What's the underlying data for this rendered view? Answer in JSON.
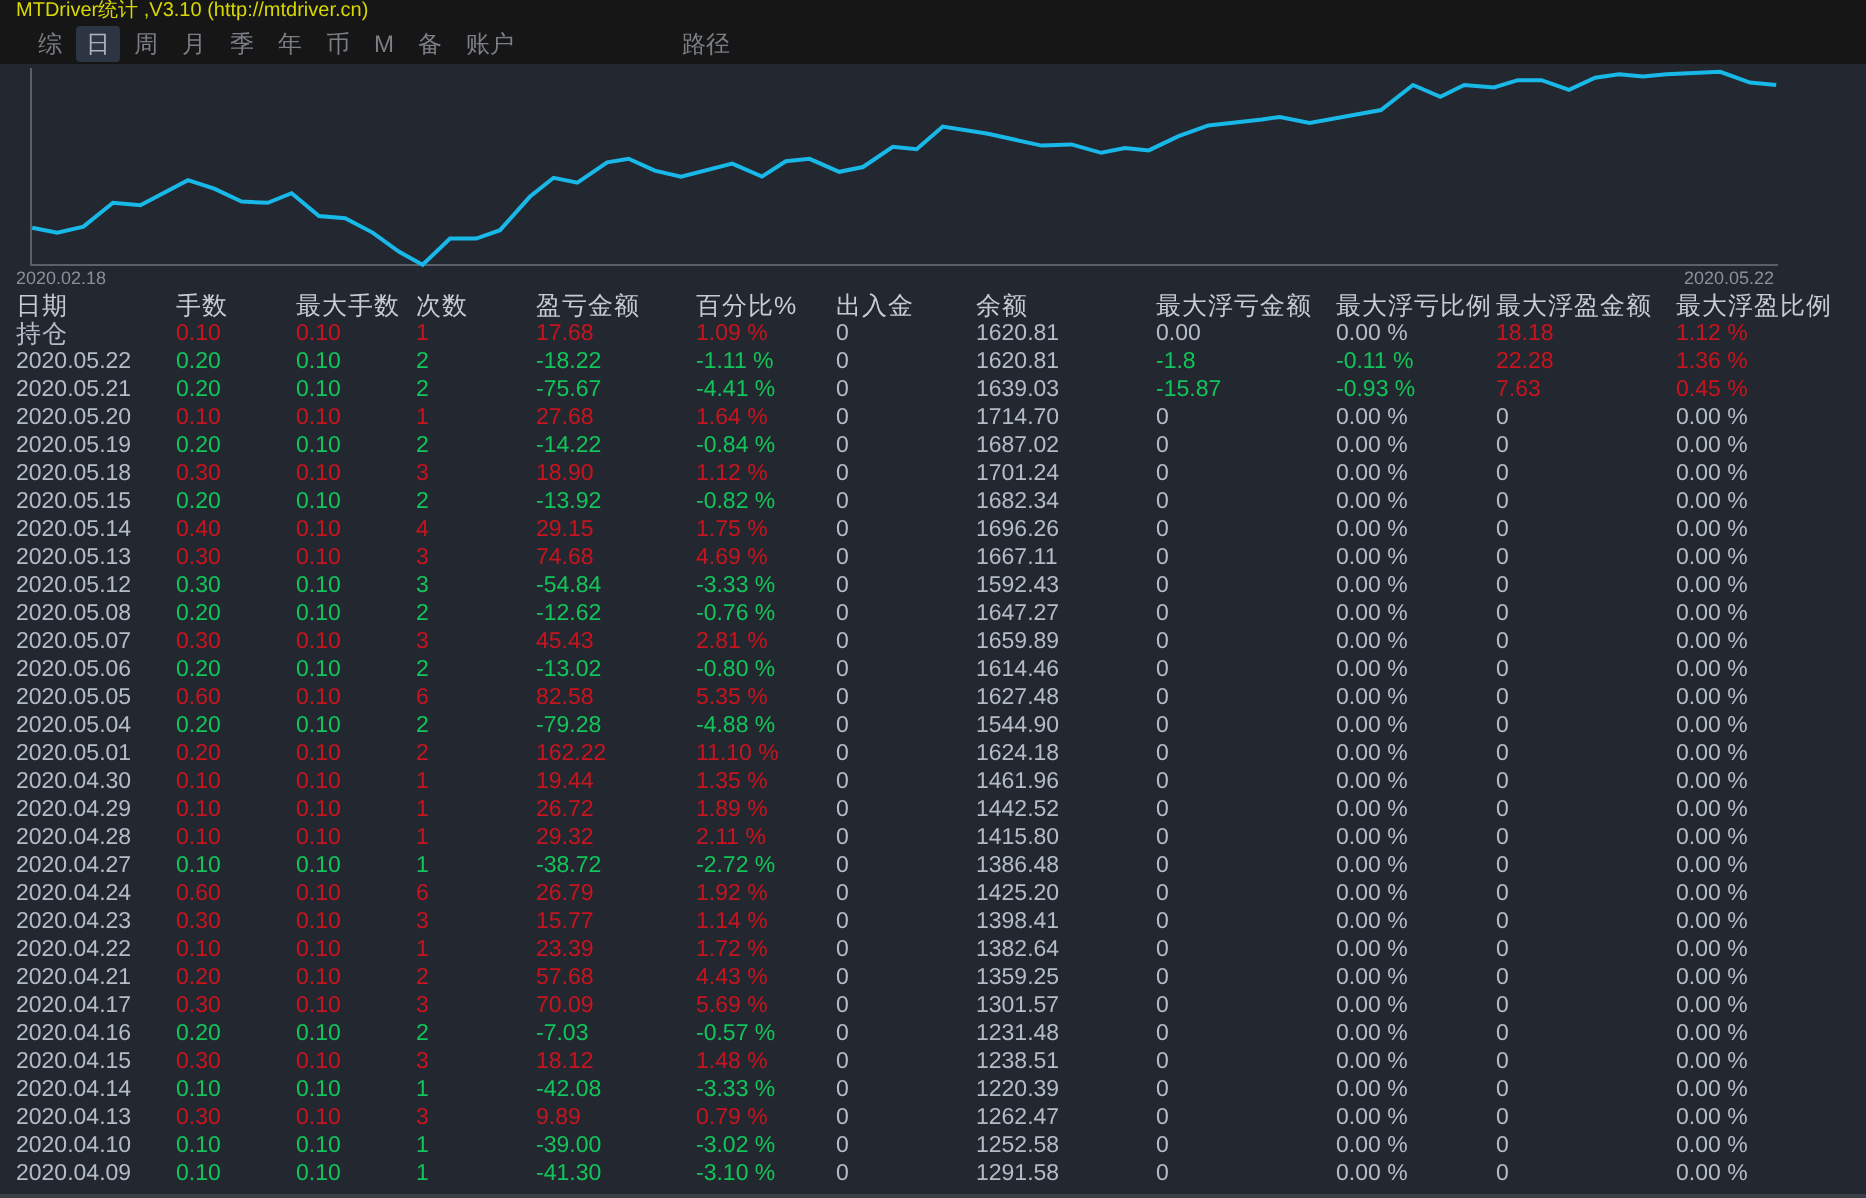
{
  "window": {
    "title": "MTDriver统计 ,V3.10 (http://mtdriver.cn)"
  },
  "tabs": [
    {
      "label": "综",
      "selected": false
    },
    {
      "label": "日",
      "selected": true
    },
    {
      "label": "周",
      "selected": false
    },
    {
      "label": "月",
      "selected": false
    },
    {
      "label": "季",
      "selected": false
    },
    {
      "label": "年",
      "selected": false
    },
    {
      "label": "币",
      "selected": false
    },
    {
      "label": "M",
      "selected": false
    },
    {
      "label": "备",
      "selected": false
    },
    {
      "label": "账户",
      "selected": false
    },
    {
      "label": "路径",
      "selected": false
    }
  ],
  "chart": {
    "start_label": "2020.02.18",
    "end_label": "2020.05.22"
  },
  "table": {
    "columns": [
      "日期",
      "手数",
      "最大手数",
      "次数",
      "盈亏金额",
      "百分比%",
      "出入金",
      "余额",
      "最大浮亏金额",
      "最大浮亏比例",
      "最大浮盈金额",
      "最大浮盈比例"
    ],
    "rows": [
      {
        "cells": [
          "持仓",
          "0.10",
          "0.10",
          "1",
          "17.68",
          "1.09 %",
          "0",
          "1620.81",
          "0.00",
          "0.00 %",
          "18.18",
          "1.12 %"
        ],
        "gain": true,
        "float_loss_marked": false,
        "float_profit_marked": true
      },
      {
        "cells": [
          "2020.05.22",
          "0.20",
          "0.10",
          "2",
          "-18.22",
          "-1.11 %",
          "0",
          "1620.81",
          "-1.8",
          "-0.11 %",
          "22.28",
          "1.36 %"
        ],
        "gain": false,
        "float_loss_marked": true,
        "float_profit_marked": true
      },
      {
        "cells": [
          "2020.05.21",
          "0.20",
          "0.10",
          "2",
          "-75.67",
          "-4.41 %",
          "0",
          "1639.03",
          "-15.87",
          "-0.93 %",
          "7.63",
          "0.45 %"
        ],
        "gain": false,
        "float_loss_marked": true,
        "float_profit_marked": true
      },
      {
        "cells": [
          "2020.05.20",
          "0.10",
          "0.10",
          "1",
          "27.68",
          "1.64 %",
          "0",
          "1714.70",
          "0",
          "0.00 %",
          "0",
          "0.00 %"
        ],
        "gain": true,
        "float_loss_marked": false,
        "float_profit_marked": false
      },
      {
        "cells": [
          "2020.05.19",
          "0.20",
          "0.10",
          "2",
          "-14.22",
          "-0.84 %",
          "0",
          "1687.02",
          "0",
          "0.00 %",
          "0",
          "0.00 %"
        ],
        "gain": false,
        "float_loss_marked": false,
        "float_profit_marked": false
      },
      {
        "cells": [
          "2020.05.18",
          "0.30",
          "0.10",
          "3",
          "18.90",
          "1.12 %",
          "0",
          "1701.24",
          "0",
          "0.00 %",
          "0",
          "0.00 %"
        ],
        "gain": true,
        "float_loss_marked": false,
        "float_profit_marked": false
      },
      {
        "cells": [
          "2020.05.15",
          "0.20",
          "0.10",
          "2",
          "-13.92",
          "-0.82 %",
          "0",
          "1682.34",
          "0",
          "0.00 %",
          "0",
          "0.00 %"
        ],
        "gain": false,
        "float_loss_marked": false,
        "float_profit_marked": false
      },
      {
        "cells": [
          "2020.05.14",
          "0.40",
          "0.10",
          "4",
          "29.15",
          "1.75 %",
          "0",
          "1696.26",
          "0",
          "0.00 %",
          "0",
          "0.00 %"
        ],
        "gain": true,
        "float_loss_marked": false,
        "float_profit_marked": false
      },
      {
        "cells": [
          "2020.05.13",
          "0.30",
          "0.10",
          "3",
          "74.68",
          "4.69 %",
          "0",
          "1667.11",
          "0",
          "0.00 %",
          "0",
          "0.00 %"
        ],
        "gain": true,
        "float_loss_marked": false,
        "float_profit_marked": false
      },
      {
        "cells": [
          "2020.05.12",
          "0.30",
          "0.10",
          "3",
          "-54.84",
          "-3.33 %",
          "0",
          "1592.43",
          "0",
          "0.00 %",
          "0",
          "0.00 %"
        ],
        "gain": false,
        "float_loss_marked": false,
        "float_profit_marked": false
      },
      {
        "cells": [
          "2020.05.08",
          "0.20",
          "0.10",
          "2",
          "-12.62",
          "-0.76 %",
          "0",
          "1647.27",
          "0",
          "0.00 %",
          "0",
          "0.00 %"
        ],
        "gain": false,
        "float_loss_marked": false,
        "float_profit_marked": false
      },
      {
        "cells": [
          "2020.05.07",
          "0.30",
          "0.10",
          "3",
          "45.43",
          "2.81 %",
          "0",
          "1659.89",
          "0",
          "0.00 %",
          "0",
          "0.00 %"
        ],
        "gain": true,
        "float_loss_marked": false,
        "float_profit_marked": false
      },
      {
        "cells": [
          "2020.05.06",
          "0.20",
          "0.10",
          "2",
          "-13.02",
          "-0.80 %",
          "0",
          "1614.46",
          "0",
          "0.00 %",
          "0",
          "0.00 %"
        ],
        "gain": false,
        "float_loss_marked": false,
        "float_profit_marked": false
      },
      {
        "cells": [
          "2020.05.05",
          "0.60",
          "0.10",
          "6",
          "82.58",
          "5.35 %",
          "0",
          "1627.48",
          "0",
          "0.00 %",
          "0",
          "0.00 %"
        ],
        "gain": true,
        "float_loss_marked": false,
        "float_profit_marked": false
      },
      {
        "cells": [
          "2020.05.04",
          "0.20",
          "0.10",
          "2",
          "-79.28",
          "-4.88 %",
          "0",
          "1544.90",
          "0",
          "0.00 %",
          "0",
          "0.00 %"
        ],
        "gain": false,
        "float_loss_marked": false,
        "float_profit_marked": false
      },
      {
        "cells": [
          "2020.05.01",
          "0.20",
          "0.10",
          "2",
          "162.22",
          "11.10 %",
          "0",
          "1624.18",
          "0",
          "0.00 %",
          "0",
          "0.00 %"
        ],
        "gain": true,
        "float_loss_marked": false,
        "float_profit_marked": false
      },
      {
        "cells": [
          "2020.04.30",
          "0.10",
          "0.10",
          "1",
          "19.44",
          "1.35 %",
          "0",
          "1461.96",
          "0",
          "0.00 %",
          "0",
          "0.00 %"
        ],
        "gain": true,
        "float_loss_marked": false,
        "float_profit_marked": false
      },
      {
        "cells": [
          "2020.04.29",
          "0.10",
          "0.10",
          "1",
          "26.72",
          "1.89 %",
          "0",
          "1442.52",
          "0",
          "0.00 %",
          "0",
          "0.00 %"
        ],
        "gain": true,
        "float_loss_marked": false,
        "float_profit_marked": false
      },
      {
        "cells": [
          "2020.04.28",
          "0.10",
          "0.10",
          "1",
          "29.32",
          "2.11 %",
          "0",
          "1415.80",
          "0",
          "0.00 %",
          "0",
          "0.00 %"
        ],
        "gain": true,
        "float_loss_marked": false,
        "float_profit_marked": false
      },
      {
        "cells": [
          "2020.04.27",
          "0.10",
          "0.10",
          "1",
          "-38.72",
          "-2.72 %",
          "0",
          "1386.48",
          "0",
          "0.00 %",
          "0",
          "0.00 %"
        ],
        "gain": false,
        "float_loss_marked": false,
        "float_profit_marked": false
      },
      {
        "cells": [
          "2020.04.24",
          "0.60",
          "0.10",
          "6",
          "26.79",
          "1.92 %",
          "0",
          "1425.20",
          "0",
          "0.00 %",
          "0",
          "0.00 %"
        ],
        "gain": true,
        "float_loss_marked": false,
        "float_profit_marked": false
      },
      {
        "cells": [
          "2020.04.23",
          "0.30",
          "0.10",
          "3",
          "15.77",
          "1.14 %",
          "0",
          "1398.41",
          "0",
          "0.00 %",
          "0",
          "0.00 %"
        ],
        "gain": true,
        "float_loss_marked": false,
        "float_profit_marked": false
      },
      {
        "cells": [
          "2020.04.22",
          "0.10",
          "0.10",
          "1",
          "23.39",
          "1.72 %",
          "0",
          "1382.64",
          "0",
          "0.00 %",
          "0",
          "0.00 %"
        ],
        "gain": true,
        "float_loss_marked": false,
        "float_profit_marked": false
      },
      {
        "cells": [
          "2020.04.21",
          "0.20",
          "0.10",
          "2",
          "57.68",
          "4.43 %",
          "0",
          "1359.25",
          "0",
          "0.00 %",
          "0",
          "0.00 %"
        ],
        "gain": true,
        "float_loss_marked": false,
        "float_profit_marked": false
      },
      {
        "cells": [
          "2020.04.17",
          "0.30",
          "0.10",
          "3",
          "70.09",
          "5.69 %",
          "0",
          "1301.57",
          "0",
          "0.00 %",
          "0",
          "0.00 %"
        ],
        "gain": true,
        "float_loss_marked": false,
        "float_profit_marked": false
      },
      {
        "cells": [
          "2020.04.16",
          "0.20",
          "0.10",
          "2",
          "-7.03",
          "-0.57 %",
          "0",
          "1231.48",
          "0",
          "0.00 %",
          "0",
          "0.00 %"
        ],
        "gain": false,
        "float_loss_marked": false,
        "float_profit_marked": false
      },
      {
        "cells": [
          "2020.04.15",
          "0.30",
          "0.10",
          "3",
          "18.12",
          "1.48 %",
          "0",
          "1238.51",
          "0",
          "0.00 %",
          "0",
          "0.00 %"
        ],
        "gain": true,
        "float_loss_marked": false,
        "float_profit_marked": false
      },
      {
        "cells": [
          "2020.04.14",
          "0.10",
          "0.10",
          "1",
          "-42.08",
          "-3.33 %",
          "0",
          "1220.39",
          "0",
          "0.00 %",
          "0",
          "0.00 %"
        ],
        "gain": false,
        "float_loss_marked": false,
        "float_profit_marked": false
      },
      {
        "cells": [
          "2020.04.13",
          "0.30",
          "0.10",
          "3",
          "9.89",
          "0.79 %",
          "0",
          "1262.47",
          "0",
          "0.00 %",
          "0",
          "0.00 %"
        ],
        "gain": true,
        "float_loss_marked": false,
        "float_profit_marked": false
      },
      {
        "cells": [
          "2020.04.10",
          "0.10",
          "0.10",
          "1",
          "-39.00",
          "-3.02 %",
          "0",
          "1252.58",
          "0",
          "0.00 %",
          "0",
          "0.00 %"
        ],
        "gain": false,
        "float_loss_marked": false,
        "float_profit_marked": false
      },
      {
        "cells": [
          "2020.04.09",
          "0.10",
          "0.10",
          "1",
          "-41.30",
          "-3.10 %",
          "0",
          "1291.58",
          "0",
          "0.00 %",
          "0",
          "0.00 %"
        ],
        "gain": false,
        "float_loss_marked": false,
        "float_profit_marked": false
      }
    ]
  }
}
